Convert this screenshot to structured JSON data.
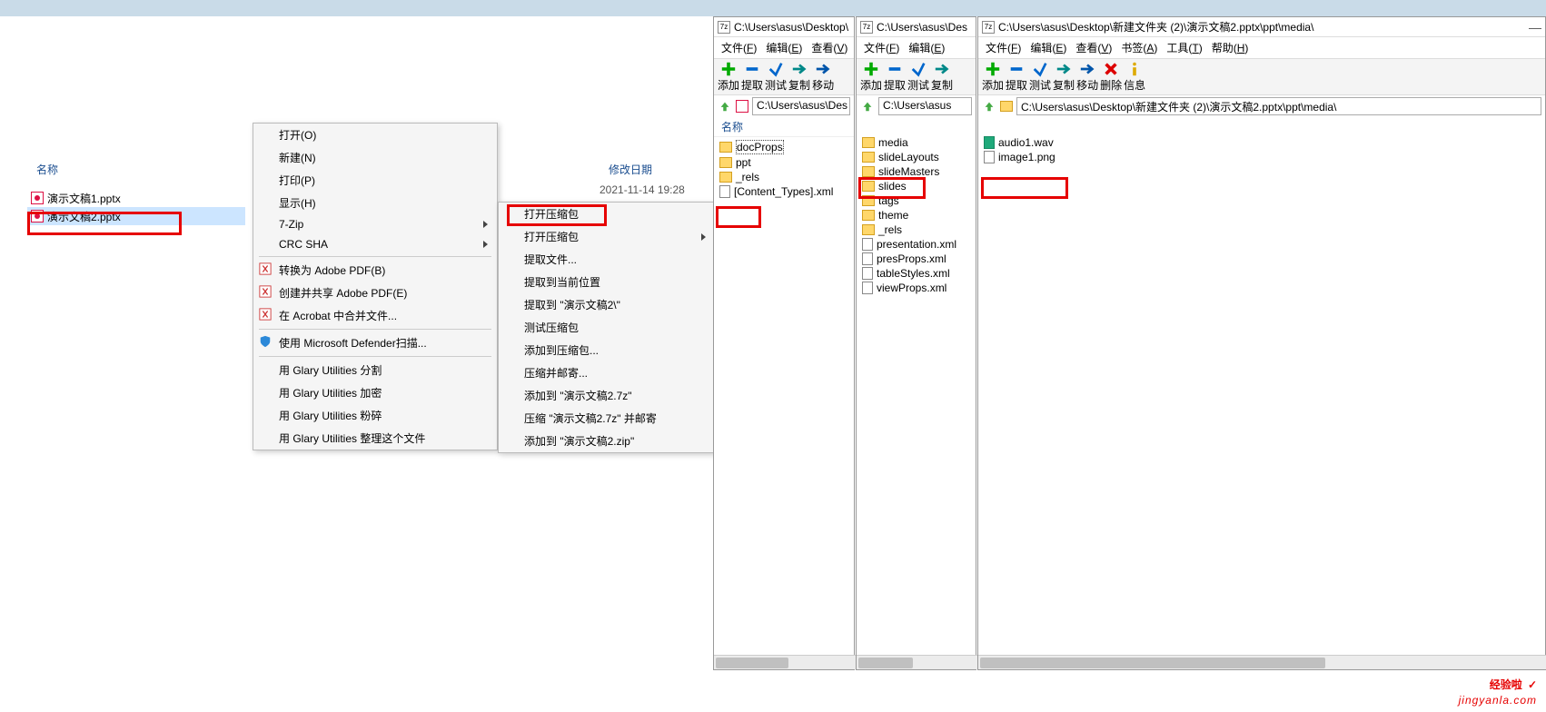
{
  "explorer": {
    "col_name": "名称",
    "col_date": "修改日期",
    "files": [
      {
        "name": "演示文稿1.pptx"
      },
      {
        "name": "演示文稿2.pptx"
      }
    ],
    "file2_date": "2021-11-14 19:28"
  },
  "context_menu": {
    "items": [
      {
        "label": "打开(O)"
      },
      {
        "label": "新建(N)"
      },
      {
        "label": "打印(P)"
      },
      {
        "label": "显示(H)"
      },
      {
        "label": "7-Zip",
        "arrow": true
      },
      {
        "label": "CRC SHA",
        "arrow": true
      },
      {
        "label": "转换为 Adobe PDF(B)",
        "icon": "pdf"
      },
      {
        "label": "创建并共享 Adobe PDF(E)",
        "icon": "pdf"
      },
      {
        "label": "在 Acrobat 中合并文件...",
        "icon": "pdf"
      },
      {
        "label": "使用 Microsoft Defender扫描...",
        "icon": "shield"
      },
      {
        "label": "用 Glary Utilities 分割"
      },
      {
        "label": "用 Glary Utilities 加密"
      },
      {
        "label": "用 Glary Utilities 粉碎"
      },
      {
        "label": "用 Glary Utilities 整理这个文件"
      }
    ]
  },
  "submenu": {
    "items": [
      "打开压缩包",
      "打开压缩包",
      "提取文件...",
      "提取到当前位置",
      "提取到 \"演示文稿2\\\"",
      "测试压缩包",
      "添加到压缩包...",
      "压缩并邮寄...",
      "添加到 \"演示文稿2.7z\"",
      "压缩 \"演示文稿2.7z\" 并邮寄",
      "添加到 \"演示文稿2.zip\""
    ],
    "item1_arrow": true
  },
  "seven": {
    "menus": {
      "file": "文件(F)",
      "edit": "编辑(E)",
      "view": "查看(V)",
      "bookmark": "书签(A)",
      "tools": "工具(T)",
      "help": "帮助(H)"
    },
    "tools": {
      "add": "添加",
      "extract": "提取",
      "test": "测试",
      "copy": "复制",
      "move": "移动",
      "delete": "删除",
      "info": "信息"
    },
    "name_header": "名称"
  },
  "sw1": {
    "title": "C:\\Users\\asus\\Desktop\\",
    "path": "C:\\Users\\asus\\Des",
    "items": [
      {
        "name": "docProps",
        "type": "folder",
        "dotted": true
      },
      {
        "name": "ppt",
        "type": "folder"
      },
      {
        "name": "_rels",
        "type": "folder"
      },
      {
        "name": "[Content_Types].xml",
        "type": "doc"
      }
    ]
  },
  "sw2": {
    "title": "C:\\Users\\asus\\Des",
    "path": "C:\\Users\\asus",
    "items": [
      {
        "name": "media",
        "type": "folder"
      },
      {
        "name": "slideLayouts",
        "type": "folder"
      },
      {
        "name": "slideMasters",
        "type": "folder"
      },
      {
        "name": "slides",
        "type": "folder"
      },
      {
        "name": "tags",
        "type": "folder"
      },
      {
        "name": "theme",
        "type": "folder"
      },
      {
        "name": "_rels",
        "type": "folder"
      },
      {
        "name": "presentation.xml",
        "type": "doc"
      },
      {
        "name": "presProps.xml",
        "type": "doc"
      },
      {
        "name": "tableStyles.xml",
        "type": "doc"
      },
      {
        "name": "viewProps.xml",
        "type": "doc"
      }
    ]
  },
  "sw3": {
    "title": "C:\\Users\\asus\\Desktop\\新建文件夹 (2)\\演示文稿2.pptx\\ppt\\media\\",
    "path": "C:\\Users\\asus\\Desktop\\新建文件夹 (2)\\演示文稿2.pptx\\ppt\\media\\",
    "items": [
      {
        "name": "audio1.wav",
        "type": "audio"
      },
      {
        "name": "image1.png",
        "type": "doc"
      }
    ]
  },
  "watermark": {
    "line1": "经验啦",
    "line2": "jingyanla.com"
  }
}
